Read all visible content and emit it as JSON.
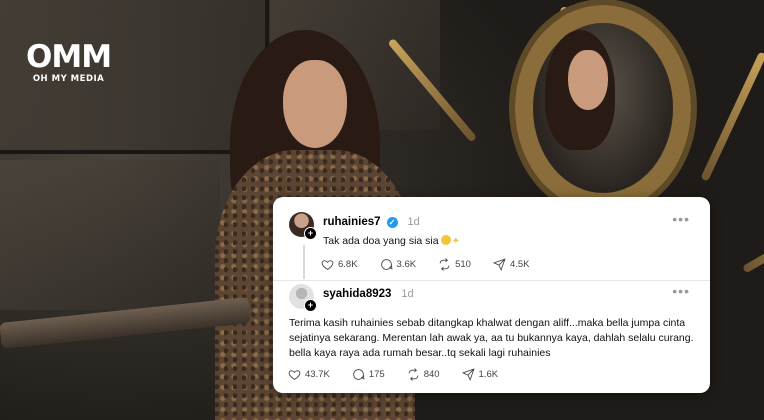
{
  "logo": {
    "mark": "OMM",
    "text": "OH MY MEDIA"
  },
  "posts": [
    {
      "username": "ruhainies7",
      "verified": true,
      "time": "1d",
      "text": "Tak ada doa yang sia sia",
      "likes": "6.8K",
      "comments": "3.6K",
      "reposts": "510",
      "shares": "4.5K"
    },
    {
      "username": "syahida8923",
      "verified": false,
      "time": "1d",
      "text_lines": [
        "Terima kasih ruhainies sebab ditangkap khalwat dengan aliff...maka bella jumpa cinta",
        "sejatinya sekarang. Merentan lah awak ya, aa tu bukannya kaya, dahlah selalu curang.",
        "bella kaya raya ada rumah besar..tq sekali lagi ruhainies"
      ],
      "likes": "43.7K",
      "comments": "175",
      "reposts": "840",
      "shares": "1.6K"
    }
  ],
  "icons": [
    "heart-icon",
    "comment-icon",
    "repost-icon",
    "share-icon",
    "more-icon",
    "verified-icon",
    "follow-plus-icon"
  ]
}
